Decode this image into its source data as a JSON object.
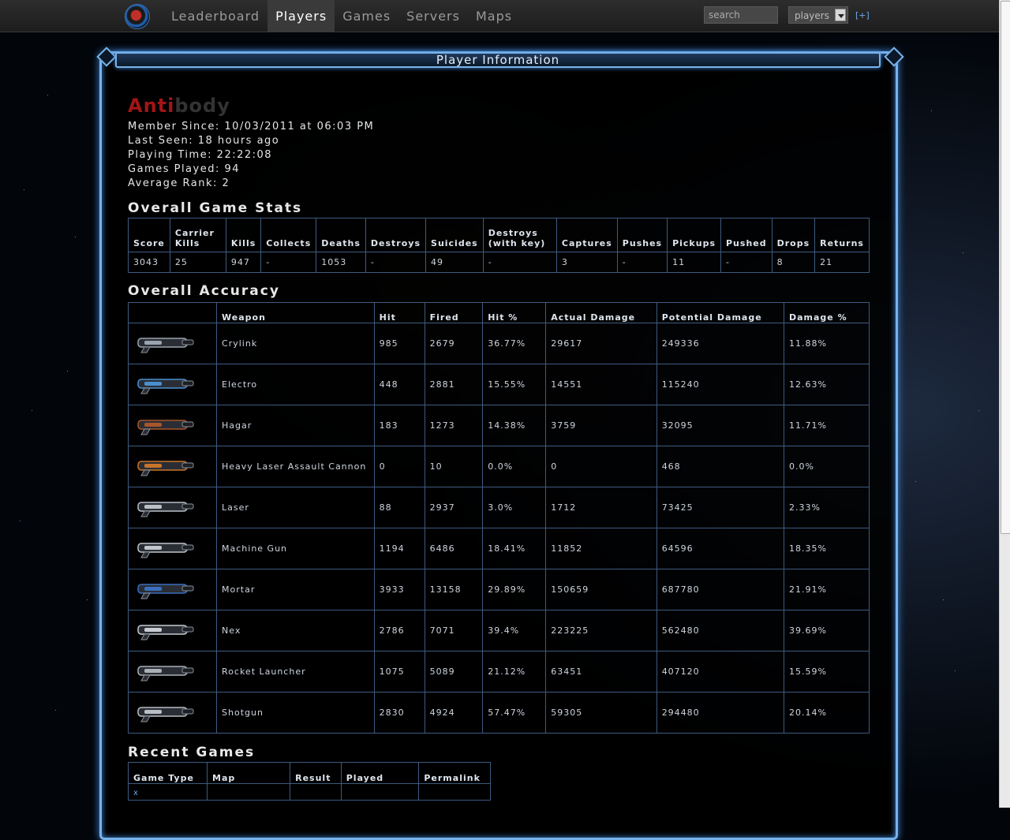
{
  "nav": {
    "items": [
      "Leaderboard",
      "Players",
      "Games",
      "Servers",
      "Maps"
    ],
    "active": "Players",
    "search_placeholder": "search",
    "select_value": "players",
    "plus_label": "[+]"
  },
  "panel": {
    "title": "Player Information"
  },
  "player": {
    "name_part1": "Anti",
    "name_part2": "body",
    "info": [
      "Member Since: 10/03/2011 at 06:03 PM",
      "Last Seen: 18 hours ago",
      "Playing Time: 22:22:08",
      "Games Played: 94",
      "Average Rank: 2"
    ]
  },
  "stats": {
    "title": "Overall Game Stats",
    "headers": [
      "Score",
      "Carrier Kills",
      "Kills",
      "Collects",
      "Deaths",
      "Destroys",
      "Suicides",
      "Destroys (with key)",
      "Captures",
      "Pushes",
      "Pickups",
      "Pushed",
      "Drops",
      "Returns"
    ],
    "values": [
      "3043",
      "25",
      "947",
      "-",
      "1053",
      "-",
      "49",
      "-",
      "3",
      "-",
      "11",
      "-",
      "8",
      "21"
    ]
  },
  "accuracy": {
    "title": "Overall Accuracy",
    "headers": [
      "",
      "Weapon",
      "Hit",
      "Fired",
      "Hit %",
      "Actual Damage",
      "Potential Damage",
      "Damage %"
    ],
    "rows": [
      {
        "icon": "crylink-icon",
        "weapon": "Crylink",
        "hit": "985",
        "fired": "2679",
        "hit_pct": "36.77%",
        "actual": "29617",
        "potential": "249336",
        "dmg_pct": "11.88%"
      },
      {
        "icon": "electro-icon",
        "weapon": "Electro",
        "hit": "448",
        "fired": "2881",
        "hit_pct": "15.55%",
        "actual": "14551",
        "potential": "115240",
        "dmg_pct": "12.63%"
      },
      {
        "icon": "hagar-icon",
        "weapon": "Hagar",
        "hit": "183",
        "fired": "1273",
        "hit_pct": "14.38%",
        "actual": "3759",
        "potential": "32095",
        "dmg_pct": "11.71%"
      },
      {
        "icon": "hlac-icon",
        "weapon": "Heavy Laser Assault Cannon",
        "hit": "0",
        "fired": "10",
        "hit_pct": "0.0%",
        "actual": "0",
        "potential": "468",
        "dmg_pct": "0.0%"
      },
      {
        "icon": "laser-icon",
        "weapon": "Laser",
        "hit": "88",
        "fired": "2937",
        "hit_pct": "3.0%",
        "actual": "1712",
        "potential": "73425",
        "dmg_pct": "2.33%"
      },
      {
        "icon": "machine-gun-icon",
        "weapon": "Machine Gun",
        "hit": "1194",
        "fired": "6486",
        "hit_pct": "18.41%",
        "actual": "11852",
        "potential": "64596",
        "dmg_pct": "18.35%"
      },
      {
        "icon": "mortar-icon",
        "weapon": "Mortar",
        "hit": "3933",
        "fired": "13158",
        "hit_pct": "29.89%",
        "actual": "150659",
        "potential": "687780",
        "dmg_pct": "21.91%"
      },
      {
        "icon": "nex-icon",
        "weapon": "Nex",
        "hit": "2786",
        "fired": "7071",
        "hit_pct": "39.4%",
        "actual": "223225",
        "potential": "562480",
        "dmg_pct": "39.69%"
      },
      {
        "icon": "rocket-launcher-icon",
        "weapon": "Rocket Launcher",
        "hit": "1075",
        "fired": "5089",
        "hit_pct": "21.12%",
        "actual": "63451",
        "potential": "407120",
        "dmg_pct": "15.59%"
      },
      {
        "icon": "shotgun-icon",
        "weapon": "Shotgun",
        "hit": "2830",
        "fired": "4924",
        "hit_pct": "57.47%",
        "actual": "59305",
        "potential": "294480",
        "dmg_pct": "20.14%"
      }
    ]
  },
  "recent": {
    "title": "Recent Games",
    "headers": [
      "Game Type",
      "Map",
      "Result",
      "Played",
      "Permalink"
    ],
    "first_row_mark": "x"
  }
}
